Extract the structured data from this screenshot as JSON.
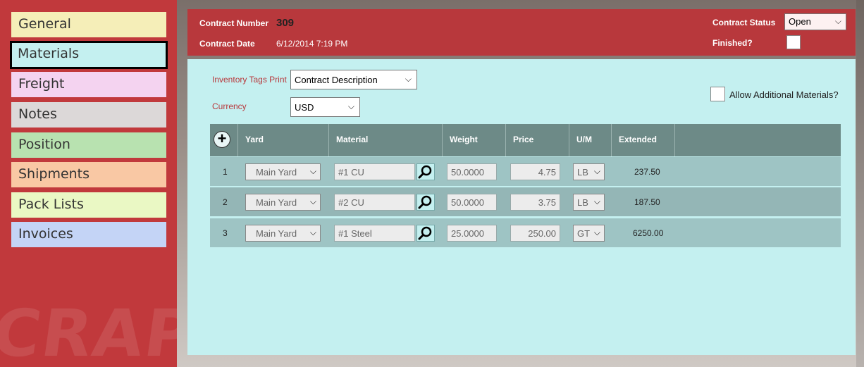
{
  "sidebar": {
    "watermark": "CRAP",
    "items": [
      {
        "label": "General",
        "color": "#f5eeb8",
        "active": false
      },
      {
        "label": "Materials",
        "color": "#c4f0f0",
        "active": true
      },
      {
        "label": "Freight",
        "color": "#f4d3f0",
        "active": false
      },
      {
        "label": "Notes",
        "color": "#dcd8d8",
        "active": false
      },
      {
        "label": "Position",
        "color": "#b8e2b0",
        "active": false
      },
      {
        "label": "Shipments",
        "color": "#f9c8a4",
        "active": false
      },
      {
        "label": "Pack Lists",
        "color": "#eaf8c4",
        "active": false
      },
      {
        "label": "Invoices",
        "color": "#c4d4f6",
        "active": false
      }
    ]
  },
  "header": {
    "contract_number_label": "Contract Number",
    "contract_number": "309",
    "contract_date_label": "Contract Date",
    "contract_date": "6/12/2014 7:19 PM",
    "contract_status_label": "Contract Status",
    "contract_status": "Open",
    "finished_label": "Finished?",
    "finished": false
  },
  "form": {
    "inventory_tags_label": "Inventory Tags Print",
    "inventory_tags_value": "Contract Description",
    "currency_label": "Currency",
    "currency_value": "USD",
    "allow_additional_label": "Allow Additional Materials?",
    "allow_additional": false
  },
  "table": {
    "add_icon": "plus-icon",
    "lookup_icon": "magnifier-icon",
    "columns": [
      "Yard",
      "Material",
      "Weight",
      "Price",
      "U/M",
      "Extended"
    ],
    "rows": [
      {
        "num": "1",
        "yard": "Main Yard",
        "material": "#1 CU",
        "weight": "50.0000",
        "price": "4.75",
        "um": "LB",
        "extended": "237.50"
      },
      {
        "num": "2",
        "yard": "Main Yard",
        "material": "#2 CU",
        "weight": "50.0000",
        "price": "3.75",
        "um": "LB",
        "extended": "187.50"
      },
      {
        "num": "3",
        "yard": "Main Yard",
        "material": "#1 Steel",
        "weight": "25.0000",
        "price": "250.00",
        "um": "GT",
        "extended": "6250.00"
      }
    ]
  },
  "colors": {
    "accent_red": "#b8383c",
    "panel_cyan": "#c4f0f0",
    "table_header": "#6d8a87",
    "row_a": "#9ec4c4",
    "row_b": "#94b6b6"
  }
}
